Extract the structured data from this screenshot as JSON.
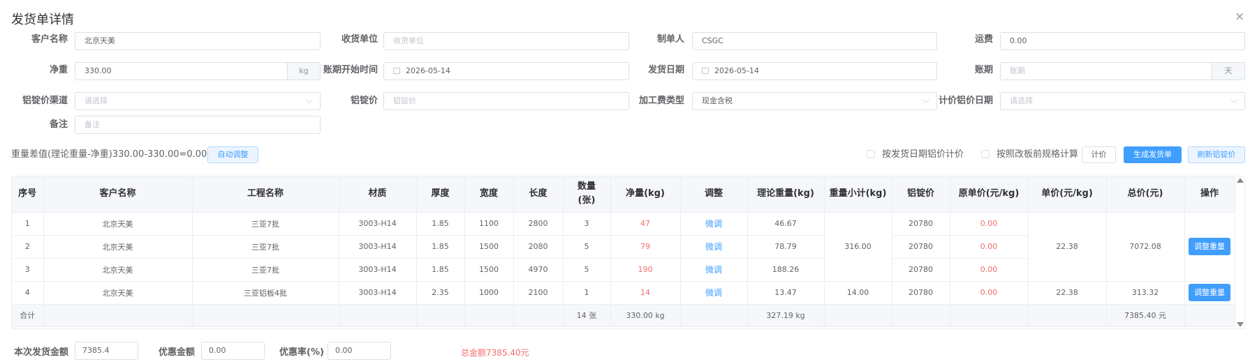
{
  "dialog": {
    "title": "发货单详情",
    "close_glyph": "×"
  },
  "form": {
    "customer": {
      "label": "客户名称",
      "value": "北京天美"
    },
    "receiver": {
      "label": "收货单位",
      "placeholder": "收货单位"
    },
    "maker": {
      "label": "制单人",
      "value": "CSGC"
    },
    "freight": {
      "label": "运费",
      "value": "0.00"
    },
    "net_weight": {
      "label": "净重",
      "value": "330.00",
      "suffix": "kg"
    },
    "period_start": {
      "label": "账期开始时间",
      "value": "2026-05-14"
    },
    "ship_date": {
      "label": "发货日期",
      "value": "2026-05-14"
    },
    "period": {
      "label": "账期",
      "placeholder": "账期",
      "suffix": "天"
    },
    "ingot_channel": {
      "label": "铝锭价渠道",
      "placeholder": "请选择"
    },
    "ingot_price": {
      "label": "铝锭价",
      "placeholder": "铝锭价"
    },
    "process_fee_type": {
      "label": "加工费类型",
      "value": "现金含税"
    },
    "pricing_date": {
      "label": "计价铝价日期",
      "placeholder": "请选择"
    },
    "remark": {
      "label": "备注",
      "placeholder": "备注"
    }
  },
  "toolbar": {
    "weight_diff": "重量差值(理论重量-净重)330.00-330.00=0.00kg",
    "auto_adjust": "自动调整",
    "cb_ship_date_price": "按发货日期铝价计价",
    "cb_pre_change_spec": "按照改板前规格计算",
    "price_btn": "计价",
    "generate_btn": "生成发货单",
    "refresh_btn": "刷新铝锭价"
  },
  "table": {
    "headers": [
      "序号",
      "客户名称",
      "工程名称",
      "材质",
      "厚度",
      "宽度",
      "长度",
      "数量(张)",
      "净量(kg)",
      "调整",
      "理论重量(kg)",
      "重量小计(kg)",
      "铝锭价",
      "原单价(元/kg)",
      "单价(元/kg)",
      "总价(元)",
      "操作"
    ],
    "rows": [
      {
        "idx": "1",
        "customer": "北京天美",
        "project": "三亚7批",
        "material": "3003-H14",
        "thickness": "1.85",
        "width": "1100",
        "length": "2800",
        "qty": "3",
        "net": "47",
        "adjust": "微调",
        "theory": "46.67",
        "ingot": "20780",
        "orig_price": "0.00"
      },
      {
        "idx": "2",
        "customer": "北京天美",
        "project": "三亚7批",
        "material": "3003-H14",
        "thickness": "1.85",
        "width": "1500",
        "length": "2080",
        "qty": "5",
        "net": "79",
        "adjust": "微调",
        "theory": "78.79",
        "ingot": "20780",
        "orig_price": "0.00"
      },
      {
        "idx": "3",
        "customer": "北京天美",
        "project": "三亚7批",
        "material": "3003-H14",
        "thickness": "1.85",
        "width": "1500",
        "length": "4970",
        "qty": "5",
        "net": "190",
        "adjust": "微调",
        "theory": "188.26",
        "ingot": "20780",
        "orig_price": "0.00"
      },
      {
        "idx": "4",
        "customer": "北京天美",
        "project": "三亚铝板4批",
        "material": "3003-H14",
        "thickness": "2.35",
        "width": "1000",
        "length": "2100",
        "qty": "1",
        "net": "14",
        "adjust": "微调",
        "theory": "13.47",
        "ingot": "20780",
        "orig_price": "0.00"
      }
    ],
    "group1": {
      "subtotal": "316.00",
      "unit_price": "22.38",
      "total": "7072.08",
      "action": "调整重量"
    },
    "group2": {
      "subtotal": "14.00",
      "unit_price": "22.38",
      "total": "313.32",
      "action": "调整重量"
    },
    "summary": {
      "label": "合计",
      "qty": "14 张",
      "net": "330.00 kg",
      "theory": "327.19 kg",
      "total": "7385.40 元"
    }
  },
  "footer": {
    "amount_label": "本次发货金额",
    "amount_value": "7385.4",
    "discount_label": "优惠金额",
    "discount_value": "0.00",
    "discount_rate_label": "优惠率(%)",
    "discount_rate_value": "0.00",
    "grand_total": "总金额7385.40元"
  },
  "colors": {
    "primary": "#409eff",
    "danger": "#f56c6c"
  }
}
